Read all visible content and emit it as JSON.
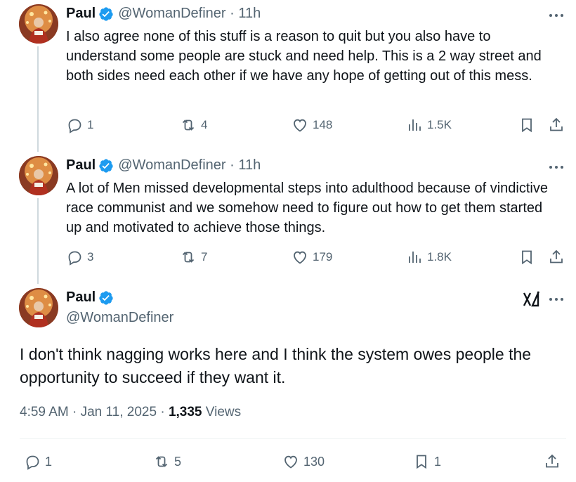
{
  "colors": {
    "text": "#0f1419",
    "secondary": "#536471",
    "verified": "#1d9bf0",
    "thread_line": "#cfd9de"
  },
  "tweets": [
    {
      "name": "Paul",
      "handle_meta": "@WomanDefiner · 11h",
      "text": "I also agree none of this stuff is a reason to quit but you also have to understand some people are stuck and need help. This is a 2 way street and both sides need each other if we have any hope of getting out of this mess.",
      "replies": "1",
      "reposts": "4",
      "likes": "148",
      "views": "1.5K"
    },
    {
      "name": "Paul",
      "handle_meta": "@WomanDefiner · 11h",
      "text": "A lot of Men missed developmental steps into adulthood because of vindictive race communist and we somehow need to figure out how to get them started up and motivated to achieve those things.",
      "replies": "3",
      "reposts": "7",
      "likes": "179",
      "views": "1.8K"
    }
  ],
  "main_tweet": {
    "name": "Paul",
    "handle": "@WomanDefiner",
    "text": "I don't think nagging works here and I think the system owes people the opportunity to succeed if they want it.",
    "time": "4:59 AM · Jan 11, 2025 · ",
    "views_count": "1,335",
    "views_label": " Views",
    "replies": "1",
    "reposts": "5",
    "likes": "130",
    "bookmarks": "1"
  }
}
